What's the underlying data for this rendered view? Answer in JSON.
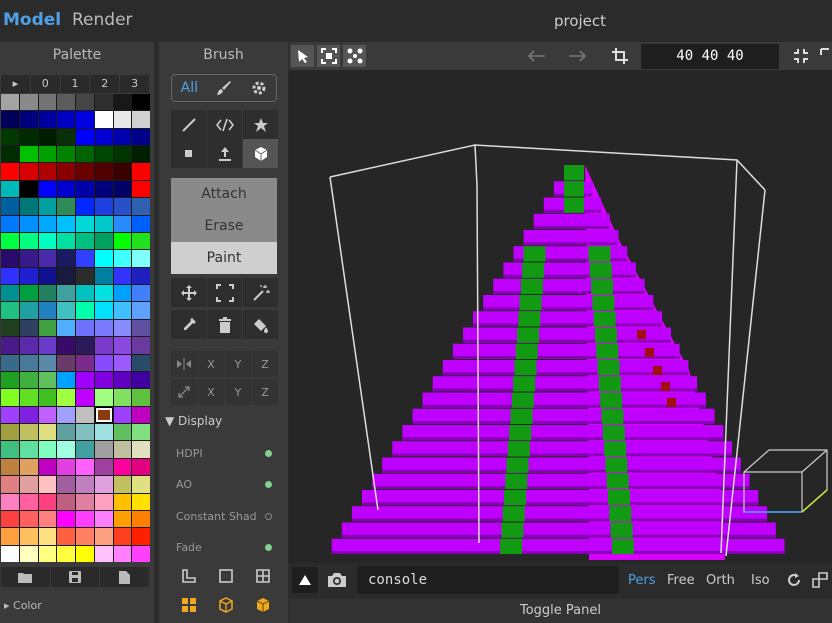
{
  "header": {
    "tab_model": "Model",
    "tab_render": "Render",
    "project": "project"
  },
  "palette": {
    "title": "Palette",
    "tabs": [
      "▸",
      "0",
      "1",
      "2",
      "3"
    ],
    "color_label": "▸ Color",
    "rows": [
      [
        "#a3a3a3",
        "#8a8a8a",
        "#737373",
        "#5c5c5c",
        "#454545",
        "#2f2f2f",
        "#181818",
        "#000000"
      ],
      [
        "#00005b",
        "#00007d",
        "#00009e",
        "#0000c0",
        "#0000e1",
        "#ffffff",
        "#e8e8e8",
        "#d1d1d1"
      ],
      [
        "#003a00",
        "#002a00",
        "#001f00",
        "#0a2f0a",
        "#0000ff",
        "#0000d6",
        "#0000b0",
        "#00008a"
      ],
      [
        "#002c00",
        "#00c000",
        "#00a000",
        "#008300",
        "#006500",
        "#004800",
        "#003500",
        "#001f00"
      ],
      [
        "#ff0000",
        "#d60000",
        "#b00000",
        "#8a0000",
        "#6a0000",
        "#500000",
        "#3a0000",
        "#ff0000"
      ],
      [
        "#00b8b8",
        "#000000",
        "#0000ff",
        "#0000d0",
        "#0000a8",
        "#00007f",
        "#000066",
        "#ff0000"
      ],
      [
        "#005f9e",
        "#007878",
        "#00a0a0",
        "#2e8b57",
        "#0028ff",
        "#1e40e0",
        "#2850c8",
        "#3060b0"
      ],
      [
        "#0078ff",
        "#0090ff",
        "#00a8ff",
        "#00c0ff",
        "#00d8d8",
        "#00c8c8",
        "#2a8aff",
        "#0060ff"
      ],
      [
        "#00ff40",
        "#00ff80",
        "#00ffc0",
        "#00e0a0",
        "#00c080",
        "#00a060",
        "#00ff00",
        "#20e020"
      ],
      [
        "#2a0a6a",
        "#3a1a8a",
        "#4a2aaa",
        "#1a1a60",
        "#3040ff",
        "#00ffff",
        "#40ffff",
        "#80ffff"
      ],
      [
        "#3030ff",
        "#2020d0",
        "#101090",
        "#1a1a40",
        "#2b2b2b",
        "#0080a0",
        "#3333ff",
        "#2020c0"
      ],
      [
        "#009090",
        "#00a040",
        "#208060",
        "#40a0a0",
        "#00c0c0",
        "#00e0e0",
        "#00a0ff",
        "#4080ff"
      ],
      [
        "#20c080",
        "#20a0a0",
        "#2080c0",
        "#40c0c0",
        "#00ffaa",
        "#00e0ff",
        "#40c0ff",
        "#60a0ff"
      ],
      [
        "#204020",
        "#304060",
        "#40a040",
        "#50b0ff",
        "#7070ff",
        "#7a7aff",
        "#8a8aff",
        "#6050a0"
      ],
      [
        "#4a1a8a",
        "#5a2aaa",
        "#6a3aca",
        "#3a0a6a",
        "#2a1a5a",
        "#7a3aca",
        "#8a4ae0",
        "#6a3aa0"
      ],
      [
        "#3a6a8a",
        "#4a7a9a",
        "#5a8aaa",
        "#6a3a6a",
        "#7a2a8a",
        "#8a4aff",
        "#9a5aff",
        "#2a4a6a"
      ],
      [
        "#20a020",
        "#40b040",
        "#60c060",
        "#00a0ff",
        "#a000ff",
        "#8000e0",
        "#6000c0",
        "#4000a0"
      ],
      [
        "#80ff20",
        "#60e020",
        "#40c020",
        "#a0ff40",
        "#c000ff",
        "#a0ff80",
        "#80e060",
        "#60c040"
      ],
      [
        "#a040ff",
        "#8020e0",
        "#c060ff",
        "#a0a0ff",
        "#c0c0c0",
        "#8a3a10",
        "#a040ff",
        "#c000c0"
      ],
      [
        "#a0a040",
        "#c0c060",
        "#e0e080",
        "#60a0a0",
        "#80c0c0",
        "#a0e0e0",
        "#60c060",
        "#80e080"
      ],
      [
        "#40c080",
        "#60e0a0",
        "#80ffc0",
        "#a0ffe0",
        "#40a0a0",
        "#a0a0a0",
        "#c0c0a0",
        "#e0e0c0"
      ],
      [
        "#c08040",
        "#e0a060",
        "#c000c0",
        "#e040e0",
        "#ff60ff",
        "#a040a0",
        "#ff00a0",
        "#e00080"
      ],
      [
        "#e08080",
        "#e0a0a0",
        "#ffc0c0",
        "#a060a0",
        "#c080c0",
        "#e0a0e0",
        "#c0c060",
        "#e0e080"
      ],
      [
        "#ff80c0",
        "#ff60a0",
        "#ff4080",
        "#c06080",
        "#e080a0",
        "#ffa0c0",
        "#ffc000",
        "#ffe000"
      ],
      [
        "#ff4040",
        "#ff6060",
        "#ff8080",
        "#ff00ff",
        "#ff40ff",
        "#ff80ff",
        "#ffa000",
        "#ff8000"
      ],
      [
        "#ffa040",
        "#ffc060",
        "#ffe080",
        "#ff6040",
        "#ff8060",
        "#ffa080",
        "#ff4020",
        "#ff2000"
      ],
      [
        "#ffffff",
        "#ffffc0",
        "#ffff80",
        "#ffff40",
        "#ffff00",
        "#ffc0ff",
        "#ff80ff",
        "#ff40ff"
      ]
    ]
  },
  "brush": {
    "title": "Brush",
    "mode_all": "All",
    "ops": {
      "attach": "Attach",
      "erase": "Erase",
      "paint": "Paint"
    },
    "axes_row1": [
      "X",
      "Y",
      "Z"
    ],
    "axes_row2": [
      "X",
      "Y",
      "Z"
    ],
    "display_head": "▼ Display",
    "display_items": [
      {
        "label": "HDPI",
        "on": true
      },
      {
        "label": "AO",
        "on": true
      },
      {
        "label": "Constant Shad",
        "on": false
      },
      {
        "label": "Fade",
        "on": true
      }
    ]
  },
  "viewport": {
    "size": "40  40  40",
    "console": "console",
    "modes": [
      "Pers",
      "Free",
      "Orth",
      "Iso"
    ],
    "toggle_panel": "Toggle Panel"
  },
  "colors": {
    "accent": "#4ea1e6",
    "voxel_purple": "#c000ff",
    "voxel_green": "#139a13",
    "voxel_red": "#a01010"
  }
}
